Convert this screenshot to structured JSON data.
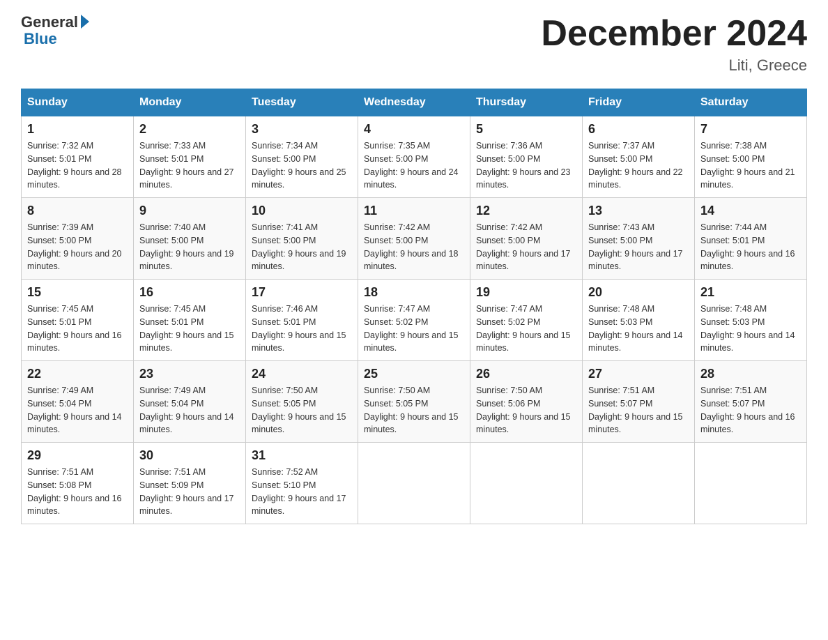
{
  "header": {
    "logo_general": "General",
    "logo_blue": "Blue",
    "month_title": "December 2024",
    "location": "Liti, Greece"
  },
  "columns": [
    "Sunday",
    "Monday",
    "Tuesday",
    "Wednesday",
    "Thursday",
    "Friday",
    "Saturday"
  ],
  "weeks": [
    [
      {
        "day": "1",
        "sunrise": "7:32 AM",
        "sunset": "5:01 PM",
        "daylight": "9 hours and 28 minutes."
      },
      {
        "day": "2",
        "sunrise": "7:33 AM",
        "sunset": "5:01 PM",
        "daylight": "9 hours and 27 minutes."
      },
      {
        "day": "3",
        "sunrise": "7:34 AM",
        "sunset": "5:00 PM",
        "daylight": "9 hours and 25 minutes."
      },
      {
        "day": "4",
        "sunrise": "7:35 AM",
        "sunset": "5:00 PM",
        "daylight": "9 hours and 24 minutes."
      },
      {
        "day": "5",
        "sunrise": "7:36 AM",
        "sunset": "5:00 PM",
        "daylight": "9 hours and 23 minutes."
      },
      {
        "day": "6",
        "sunrise": "7:37 AM",
        "sunset": "5:00 PM",
        "daylight": "9 hours and 22 minutes."
      },
      {
        "day": "7",
        "sunrise": "7:38 AM",
        "sunset": "5:00 PM",
        "daylight": "9 hours and 21 minutes."
      }
    ],
    [
      {
        "day": "8",
        "sunrise": "7:39 AM",
        "sunset": "5:00 PM",
        "daylight": "9 hours and 20 minutes."
      },
      {
        "day": "9",
        "sunrise": "7:40 AM",
        "sunset": "5:00 PM",
        "daylight": "9 hours and 19 minutes."
      },
      {
        "day": "10",
        "sunrise": "7:41 AM",
        "sunset": "5:00 PM",
        "daylight": "9 hours and 19 minutes."
      },
      {
        "day": "11",
        "sunrise": "7:42 AM",
        "sunset": "5:00 PM",
        "daylight": "9 hours and 18 minutes."
      },
      {
        "day": "12",
        "sunrise": "7:42 AM",
        "sunset": "5:00 PM",
        "daylight": "9 hours and 17 minutes."
      },
      {
        "day": "13",
        "sunrise": "7:43 AM",
        "sunset": "5:00 PM",
        "daylight": "9 hours and 17 minutes."
      },
      {
        "day": "14",
        "sunrise": "7:44 AM",
        "sunset": "5:01 PM",
        "daylight": "9 hours and 16 minutes."
      }
    ],
    [
      {
        "day": "15",
        "sunrise": "7:45 AM",
        "sunset": "5:01 PM",
        "daylight": "9 hours and 16 minutes."
      },
      {
        "day": "16",
        "sunrise": "7:45 AM",
        "sunset": "5:01 PM",
        "daylight": "9 hours and 15 minutes."
      },
      {
        "day": "17",
        "sunrise": "7:46 AM",
        "sunset": "5:01 PM",
        "daylight": "9 hours and 15 minutes."
      },
      {
        "day": "18",
        "sunrise": "7:47 AM",
        "sunset": "5:02 PM",
        "daylight": "9 hours and 15 minutes."
      },
      {
        "day": "19",
        "sunrise": "7:47 AM",
        "sunset": "5:02 PM",
        "daylight": "9 hours and 15 minutes."
      },
      {
        "day": "20",
        "sunrise": "7:48 AM",
        "sunset": "5:03 PM",
        "daylight": "9 hours and 14 minutes."
      },
      {
        "day": "21",
        "sunrise": "7:48 AM",
        "sunset": "5:03 PM",
        "daylight": "9 hours and 14 minutes."
      }
    ],
    [
      {
        "day": "22",
        "sunrise": "7:49 AM",
        "sunset": "5:04 PM",
        "daylight": "9 hours and 14 minutes."
      },
      {
        "day": "23",
        "sunrise": "7:49 AM",
        "sunset": "5:04 PM",
        "daylight": "9 hours and 14 minutes."
      },
      {
        "day": "24",
        "sunrise": "7:50 AM",
        "sunset": "5:05 PM",
        "daylight": "9 hours and 15 minutes."
      },
      {
        "day": "25",
        "sunrise": "7:50 AM",
        "sunset": "5:05 PM",
        "daylight": "9 hours and 15 minutes."
      },
      {
        "day": "26",
        "sunrise": "7:50 AM",
        "sunset": "5:06 PM",
        "daylight": "9 hours and 15 minutes."
      },
      {
        "day": "27",
        "sunrise": "7:51 AM",
        "sunset": "5:07 PM",
        "daylight": "9 hours and 15 minutes."
      },
      {
        "day": "28",
        "sunrise": "7:51 AM",
        "sunset": "5:07 PM",
        "daylight": "9 hours and 16 minutes."
      }
    ],
    [
      {
        "day": "29",
        "sunrise": "7:51 AM",
        "sunset": "5:08 PM",
        "daylight": "9 hours and 16 minutes."
      },
      {
        "day": "30",
        "sunrise": "7:51 AM",
        "sunset": "5:09 PM",
        "daylight": "9 hours and 17 minutes."
      },
      {
        "day": "31",
        "sunrise": "7:52 AM",
        "sunset": "5:10 PM",
        "daylight": "9 hours and 17 minutes."
      },
      null,
      null,
      null,
      null
    ]
  ]
}
